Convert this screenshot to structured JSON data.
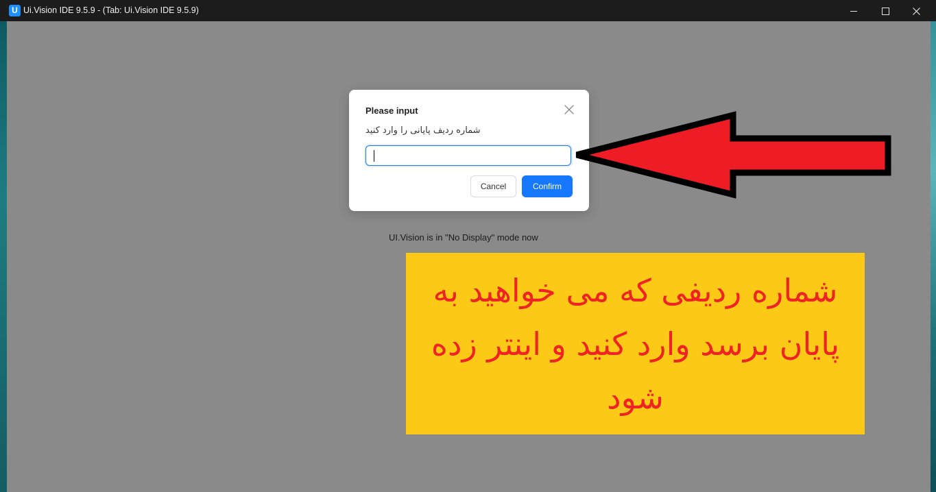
{
  "window": {
    "icon_letter": "U",
    "title": "Ui.Vision IDE 9.5.9 - (Tab: Ui.Vision IDE 9.5.9)"
  },
  "dialog": {
    "title": "Please input",
    "message": "شماره ردیف پایانی را وارد کنید",
    "input_value": "",
    "cancel_label": "Cancel",
    "confirm_label": "Confirm",
    "confirm_color": "#1677ff"
  },
  "status": {
    "text": "UI.Vision is in \"No Display\" mode now"
  },
  "annotation": {
    "arrow_fill": "#ee1c24",
    "arrow_outline": "#000000",
    "banner_color": "#fcc916",
    "banner_text": "شماره ردیفی که می خواهید به پایان برسد وارد کنید و اینتر زده شود",
    "banner_text_color": "#ee2424"
  }
}
